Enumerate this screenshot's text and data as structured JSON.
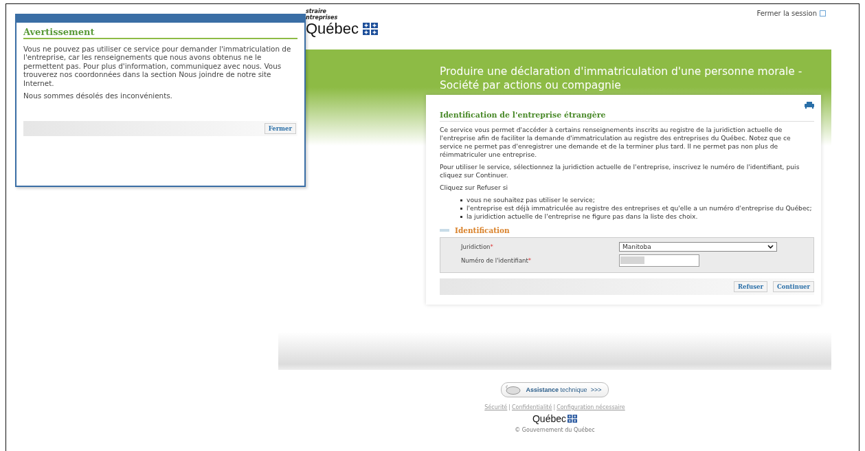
{
  "header": {
    "logo_lines": [
      "straire",
      "ntreprises"
    ],
    "logo_name": "Québec",
    "logout_link": "Fermer la session"
  },
  "page_title": "Produire une déclaration d'immatriculation d'une personne morale - Société par actions ou compagnie",
  "card": {
    "heading": "Identification de l'entreprise étrangère",
    "paragraphs": [
      "Ce service vous permet d'accéder à certains renseignements inscrits au registre de la juridiction actuelle de l'entreprise afin de faciliter la demande d'immatriculation au registre des entreprises du Québec. Notez que ce service ne permet pas d'enregistrer une demande et de la terminer plus tard. Il ne permet pas non plus de réimmatriculer une entreprise.",
      "Pour utiliser le service, sélectionnez la juridiction actuelle de l'entreprise, inscrivez le numéro de l'identifiant, puis cliquez sur Continuer.",
      "Cliquez sur Refuser si"
    ],
    "bullets": [
      "vous ne souhaitez pas utiliser le service;",
      "l'entreprise est déjà immatriculée au registre des entreprises et qu'elle a un numéro d'entreprise du Québec;",
      "la juridiction actuelle de l'entreprise ne figure pas dans la liste des choix."
    ],
    "section_title": "Identification",
    "fields": [
      {
        "kind": "select",
        "label": "Juridiction",
        "required_mark": "*",
        "value": "Manitoba"
      },
      {
        "kind": "text",
        "label": "Numéro de l'identifiant",
        "required_mark": "*",
        "redacted": true
      }
    ],
    "buttons": [
      "Refuser",
      "Continuer"
    ]
  },
  "footer": {
    "assistance": {
      "bold": "Assistance",
      "rest": "technique",
      "arrows": ">>>"
    },
    "links": [
      "Sécurité",
      "Confidentialité",
      "Configuration nécessaire"
    ],
    "separator": "|",
    "logo_name": "Québec",
    "copyright": "© Gouvernement du Québec"
  },
  "dialog": {
    "title": "Avertissement",
    "paragraphs": [
      "Vous ne pouvez pas utiliser ce service pour demander l'immatriculation de l'entreprise, car les renseignements que nous avons obtenus ne le permettent pas. Pour plus d'information, communiquez avec nous. Vous trouverez nos coordonnées dans la section Nous joindre de notre site Internet.",
      "Nous sommes désolés des inconvénients."
    ],
    "button": "Fermer"
  }
}
